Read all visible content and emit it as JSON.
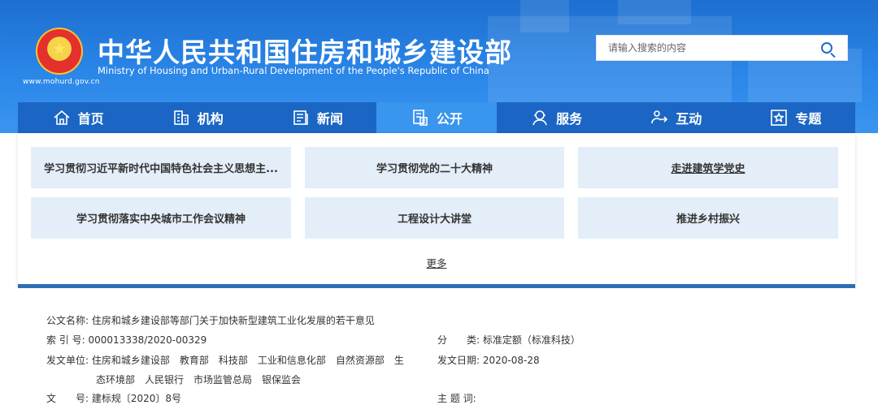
{
  "header": {
    "url": "www.mohurd.gov.cn",
    "title": "中华人民共和国住房和城乡建设部",
    "subtitle": "Ministry of Housing and Urban-Rural Development of the People's Republic of China",
    "search_placeholder": "请输入搜索的内容"
  },
  "nav": [
    {
      "label": "首页",
      "icon": "home-icon"
    },
    {
      "label": "机构",
      "icon": "building-icon"
    },
    {
      "label": "新闻",
      "icon": "news-icon"
    },
    {
      "label": "公开",
      "icon": "document-icon",
      "active": true
    },
    {
      "label": "服务",
      "icon": "service-icon"
    },
    {
      "label": "互动",
      "icon": "interaction-icon"
    },
    {
      "label": "专题",
      "icon": "star-icon"
    }
  ],
  "topics": [
    "学习贯彻习近平新时代中国特色社会主义思想主...",
    "学习贯彻党的二十大精神",
    "走进建筑学党史",
    "学习贯彻落实中央城市工作会议精神",
    "工程设计大讲堂",
    "推进乡村振兴"
  ],
  "more": "更多",
  "doc": {
    "name_label": "公文名称:",
    "name_value": "住房和城乡建设部等部门关于加快新型建筑工业化发展的若干意见",
    "index_label": "索 引 号:",
    "index_value": "000013338/2020-00329",
    "category_label": "分　　类:",
    "category_value": "标准定额（标准科技）",
    "issuer_label": "发文单位:",
    "issuer_line1": "住房和城乡建设部　教育部　科技部　工业和信息化部　自然资源部　生",
    "issuer_line2": "态环境部　人民银行　市场监管总局　银保监会",
    "date_label": "发文日期:",
    "date_value": "2020-08-28",
    "docno_label": "文　　号:",
    "docno_value": "建标规〔2020〕8号",
    "subject_label": "主 题 词:",
    "subject_value": ""
  },
  "colors": {
    "header_blue": "#2a86e8",
    "nav_blue": "#1b66c4",
    "nav_active": "#3a95ee",
    "card_bg": "#e4eef8"
  }
}
